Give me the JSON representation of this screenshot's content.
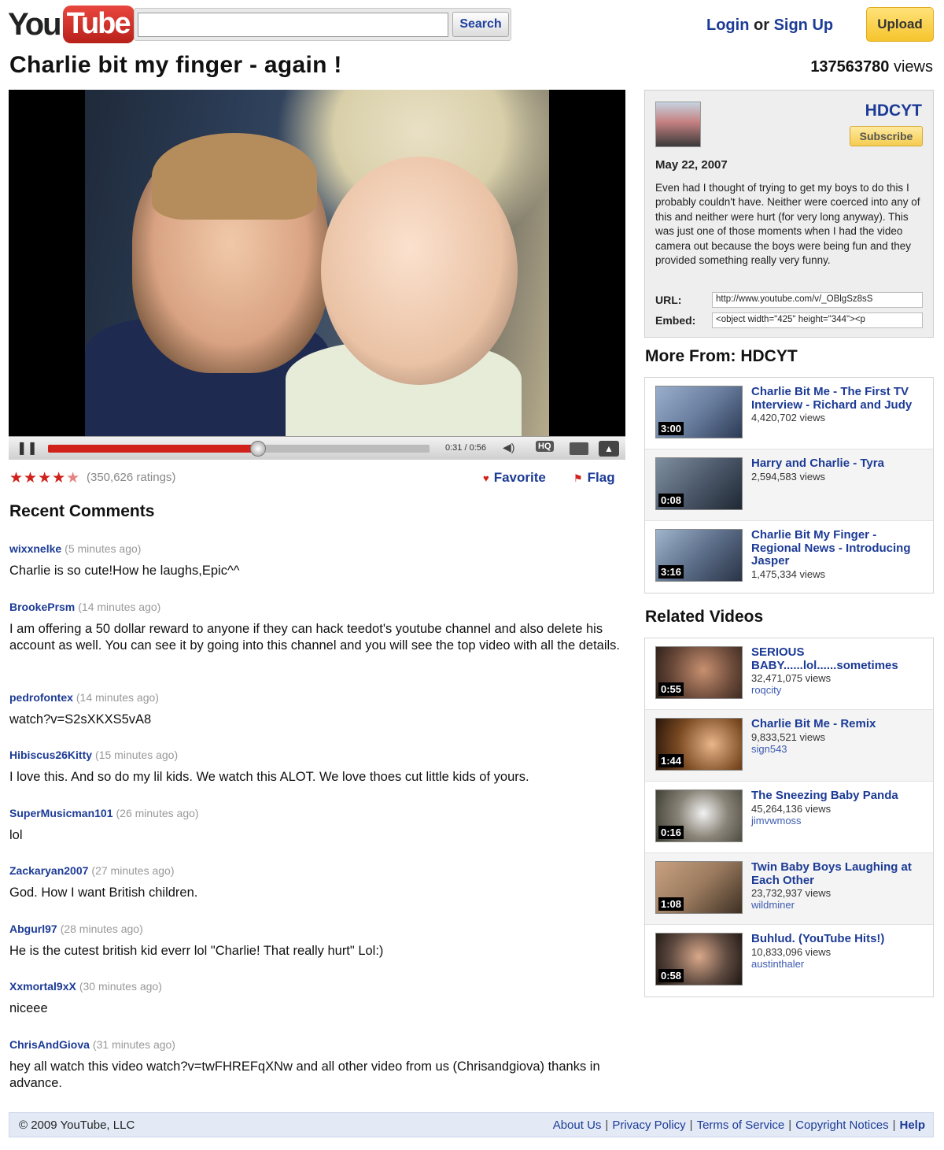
{
  "header": {
    "logo_you": "You",
    "logo_tube": "Tube",
    "search_value": "",
    "search_button": "Search",
    "login": "Login",
    "or": "or",
    "signup": "Sign Up",
    "upload": "Upload"
  },
  "video": {
    "title": "Charlie bit my finger - again !",
    "views_number": "137563780",
    "views_word": "views",
    "time": "0:31 / 0:56",
    "progress": 0.55,
    "hq_label": "HQ",
    "rating_stars": "★★★★",
    "rating_half": "★",
    "ratings": "(350,626 ratings)",
    "favorite": "Favorite",
    "flag": "Flag"
  },
  "comments_heading": "Recent Comments",
  "comments": [
    {
      "author": "wixxnelke",
      "time": "(5 minutes ago)",
      "text": "Charlie is so cute!How he laughs,Epic^^"
    },
    {
      "author": "BrookePrsm",
      "time": "(14 minutes ago)",
      "text": "I am offering a 50 dollar reward to anyone if they can hack teedot's youtube channel and also delete his account as well. You can see it by going into this channel and you will see the top video with all the details."
    },
    {
      "author": "pedrofontex",
      "time": "(14 minutes ago)",
      "text": "watch?v=S2sXKXS5vA8"
    },
    {
      "author": "Hibiscus26Kitty",
      "time": "(15 minutes ago)",
      "text": "I love this. And so do my lil kids. We watch this ALOT. We love thoes cut little kids of yours."
    },
    {
      "author": "SuperMusicman101",
      "time": "(26 minutes ago)",
      "text": "lol"
    },
    {
      "author": "Zackaryan2007",
      "time": "(27 minutes ago)",
      "text": "God. How I want British children."
    },
    {
      "author": "Abgurl97",
      "time": "(28 minutes ago)",
      "text": "He is the cutest british kid everr lol \"Charlie! That really hurt\" Lol:)"
    },
    {
      "author": "Xxmortal9xX",
      "time": "(30 minutes ago)",
      "text": "niceee"
    },
    {
      "author": "ChrisAndGiova",
      "time": "(31 minutes ago)",
      "text": "hey all watch this video watch?v=twFHREFqXNw and all other video from us (Chrisandgiova) thanks in advance."
    }
  ],
  "channel": {
    "name": "HDCYT",
    "subscribe": "Subscribe",
    "date": "May 22, 2007",
    "description": "Even had I thought of trying to get my boys to do this I probably couldn't have. Neither were coerced into any of this and neither were hurt (for very long anyway). This was just one of those moments when I had the video camera out because the boys were being fun and they provided something really very funny.",
    "url_label": "URL:",
    "url_value": "http://www.youtube.com/v/_OBlgSz8sS",
    "embed_label": "Embed:",
    "embed_value": "<object width=\"425\" height=\"344\"><p"
  },
  "more_from": {
    "heading": "More From: HDCYT",
    "items": [
      {
        "title": "Charlie Bit Me - The First TV Interview - Richard and Judy",
        "views": "4,420,702 views",
        "user": "",
        "duration": "3:00",
        "thumb": "#6a7fa0"
      },
      {
        "title": "Harry and Charlie - Tyra",
        "views": "2,594,583 views",
        "user": "",
        "duration": "0:08",
        "thumb": "#4d5a6c"
      },
      {
        "title": "Charlie Bit My Finger - Regional News - Introducing Jasper",
        "views": "1,475,334 views",
        "user": "",
        "duration": "3:16",
        "thumb": "#5d6f8a"
      }
    ]
  },
  "related": {
    "heading": "Related Videos",
    "items": [
      {
        "title": "SERIOUS BABY......lol......sometimes",
        "views": "32,471,075 views",
        "user": "roqcity",
        "duration": "0:55",
        "thumb": "#6b4a3a"
      },
      {
        "title": "Charlie Bit Me - Remix",
        "views": "9,833,521 views",
        "user": "sign543",
        "duration": "1:44",
        "thumb": "#7a4a22"
      },
      {
        "title": "The Sneezing Baby Panda",
        "views": "45,264,136 views",
        "user": "jimvwmoss",
        "duration": "0:16",
        "thumb": "#8a8478"
      },
      {
        "title": "Twin Baby Boys Laughing at Each Other",
        "views": "23,732,937 views",
        "user": "wildminer",
        "duration": "1:08",
        "thumb": "#9a7a5e"
      },
      {
        "title": "Buhlud. (YouTube Hits!)",
        "views": "10,833,096 views",
        "user": "austinthaler",
        "duration": "0:58",
        "thumb": "#5e4a40"
      }
    ]
  },
  "footer": {
    "copyright": "© 2009 YouTube, LLC",
    "links": [
      "About Us",
      "Privacy Policy",
      "Terms of Service",
      "Copyright Notices",
      "Help"
    ]
  }
}
